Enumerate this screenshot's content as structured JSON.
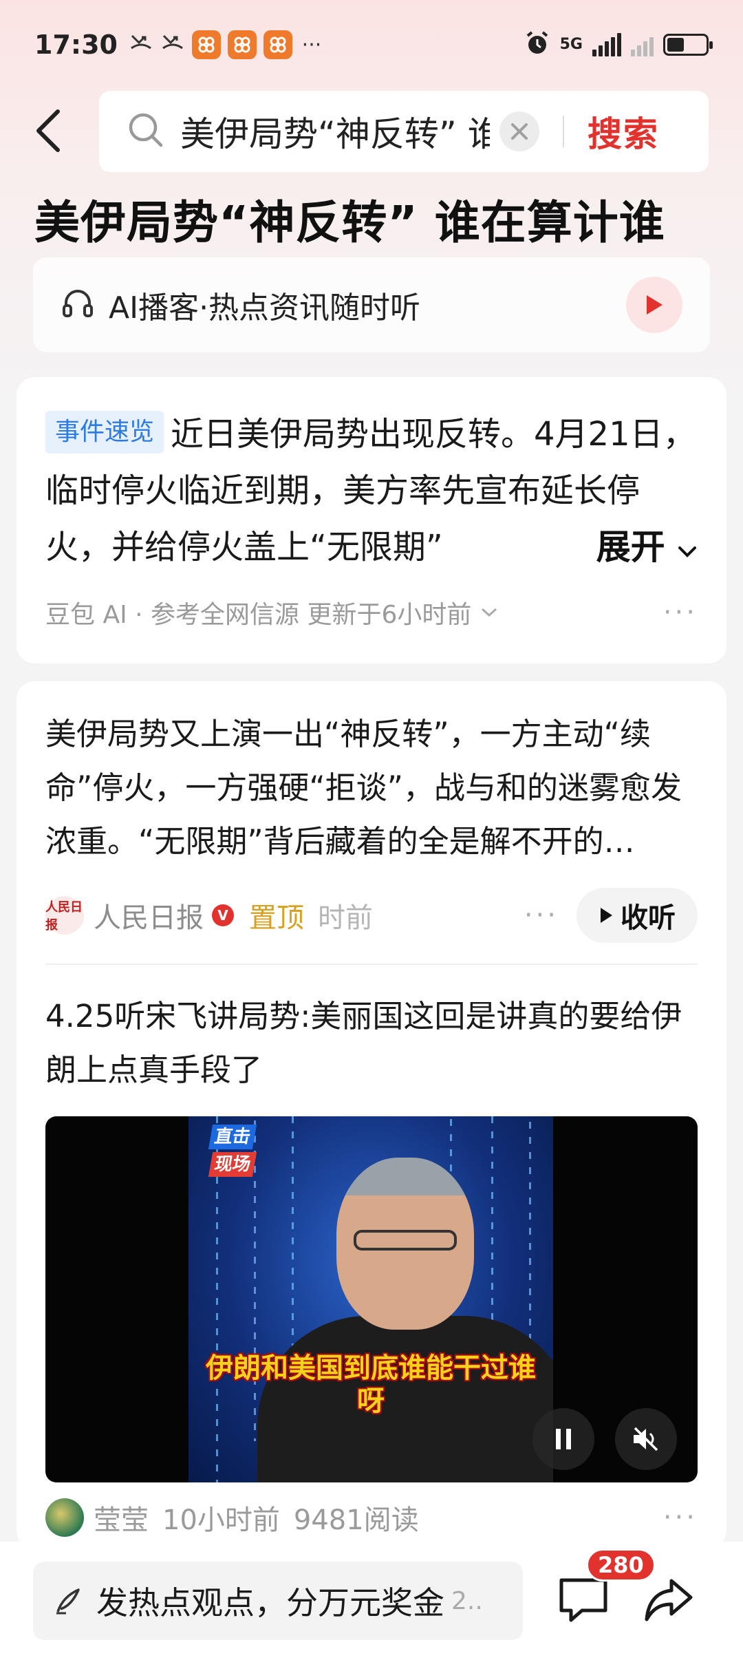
{
  "status_bar": {
    "time": "17:30",
    "network": "5G",
    "more": "···"
  },
  "search": {
    "query": "美伊局势“神反转” 谁在算计谁",
    "submit_label": "搜索"
  },
  "topic": {
    "title": "美伊局势“神反转” 谁在算计谁"
  },
  "podcast": {
    "label": "AI播客·热点资讯随时听"
  },
  "summary_card": {
    "tag": "事件速览",
    "text": "近日美伊局势出现反转。4月21日，临时停火临近到期，美方率先宣布延长停火，并给停火盖上“无限期”",
    "expand_label": "展开",
    "source": "豆包 AI · 参考全网信源 更新于6小时前",
    "more": "···"
  },
  "article": {
    "text": "美伊局势又上演一出“神反转”，一方主动“续命”停火，一方强硬“拒谈”，战与和的迷雾愈发浓重。“无限期”背后藏着的全是解不开的…",
    "logo_text": "人民日报",
    "source_name": "人民日报",
    "verified": "V",
    "pinned_label": "置顶",
    "time": "时前",
    "more": "···",
    "listen_label": "收听"
  },
  "video_post": {
    "title": "4.25听宋飞讲局势:美丽国这回是讲真的要给伊朗上点真手段了",
    "live_logo": {
      "line1": "直击",
      "line2": "现场"
    },
    "caption": "伊朗和美国到底谁能干过谁呀",
    "author": "莹莹",
    "time": "10小时前",
    "reads": "9481阅读",
    "more": "···"
  },
  "bottom_bar": {
    "placeholder": "发热点观点，分万元奖金",
    "placeholder_suffix": "2..",
    "comment_count": "280"
  },
  "colors": {
    "accent_red": "#e2322d",
    "tag_blue": "#2c7be5",
    "pinned_gold": "#d7a01f"
  }
}
